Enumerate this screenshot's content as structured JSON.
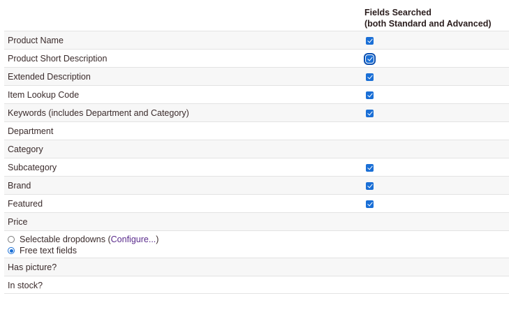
{
  "header": {
    "line1": "Fields Searched",
    "line2": "(both Standard and Advanced)"
  },
  "rows": [
    {
      "label": "Product Name",
      "checked": true
    },
    {
      "label": "Product Short Description",
      "checked": true
    },
    {
      "label": "Extended Description",
      "checked": true
    },
    {
      "label": "Item Lookup Code",
      "checked": true
    },
    {
      "label": "Keywords (includes Department and Category)",
      "checked": true
    },
    {
      "label": "Department",
      "checked": false
    },
    {
      "label": "Category",
      "checked": false
    },
    {
      "label": "Subcategory",
      "checked": true
    },
    {
      "label": "Brand",
      "checked": true
    },
    {
      "label": "Featured",
      "checked": true
    },
    {
      "label": "Price",
      "checked": false
    }
  ],
  "price_options": {
    "selectable_label": "Selectable dropdowns (",
    "configure_link": "Configure...",
    "selectable_close": ")",
    "free_text_label": "Free text fields",
    "selected": "free_text"
  },
  "extra_rows": [
    {
      "label": "Has picture?"
    },
    {
      "label": "In stock?"
    }
  ],
  "colors": {
    "checkbox": "#1a6fd6",
    "link": "#5a2b8c"
  }
}
